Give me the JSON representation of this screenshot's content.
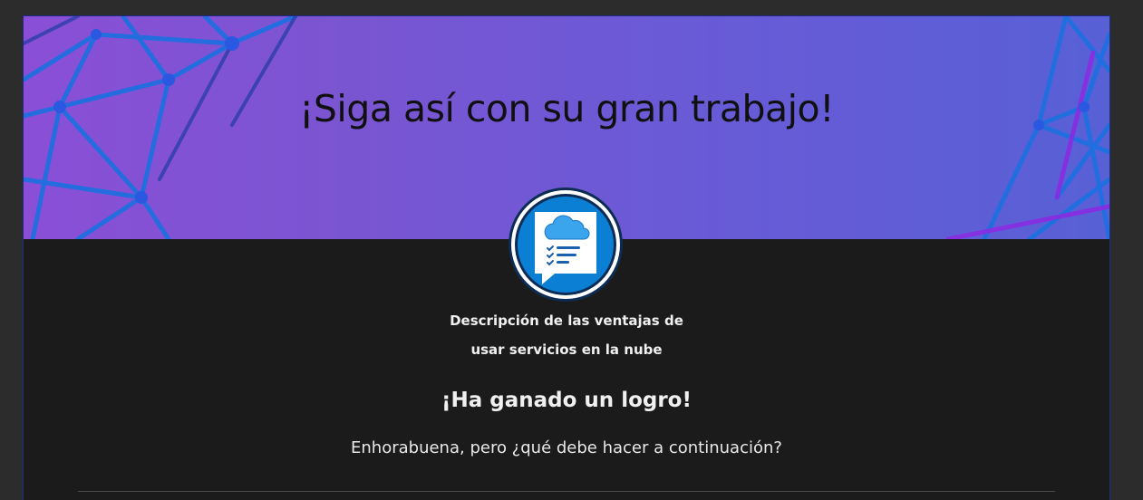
{
  "banner": {
    "title": "¡Siga así con su gran trabajo!"
  },
  "badge": {
    "icon": "cloud-checklist-icon",
    "colors": {
      "ring": "#ffffff",
      "fill": "#0a7fd4",
      "dark_ring": "#0d2c55",
      "card": "#ffffff"
    }
  },
  "module": {
    "title_line1": "Descripción de las ventajas de",
    "title_line2": "usar servicios en la nube"
  },
  "achievement": {
    "heading": "¡Ha ganado un logro!",
    "next_question": "Enhorabuena, pero ¿qué debe hacer a continuación?"
  },
  "colors": {
    "background": "#2c2c2c",
    "dialog": "#1b1b1b",
    "banner_start": "#8a4fd6",
    "banner_end": "#5860d6",
    "network": "#1e6fe0"
  }
}
